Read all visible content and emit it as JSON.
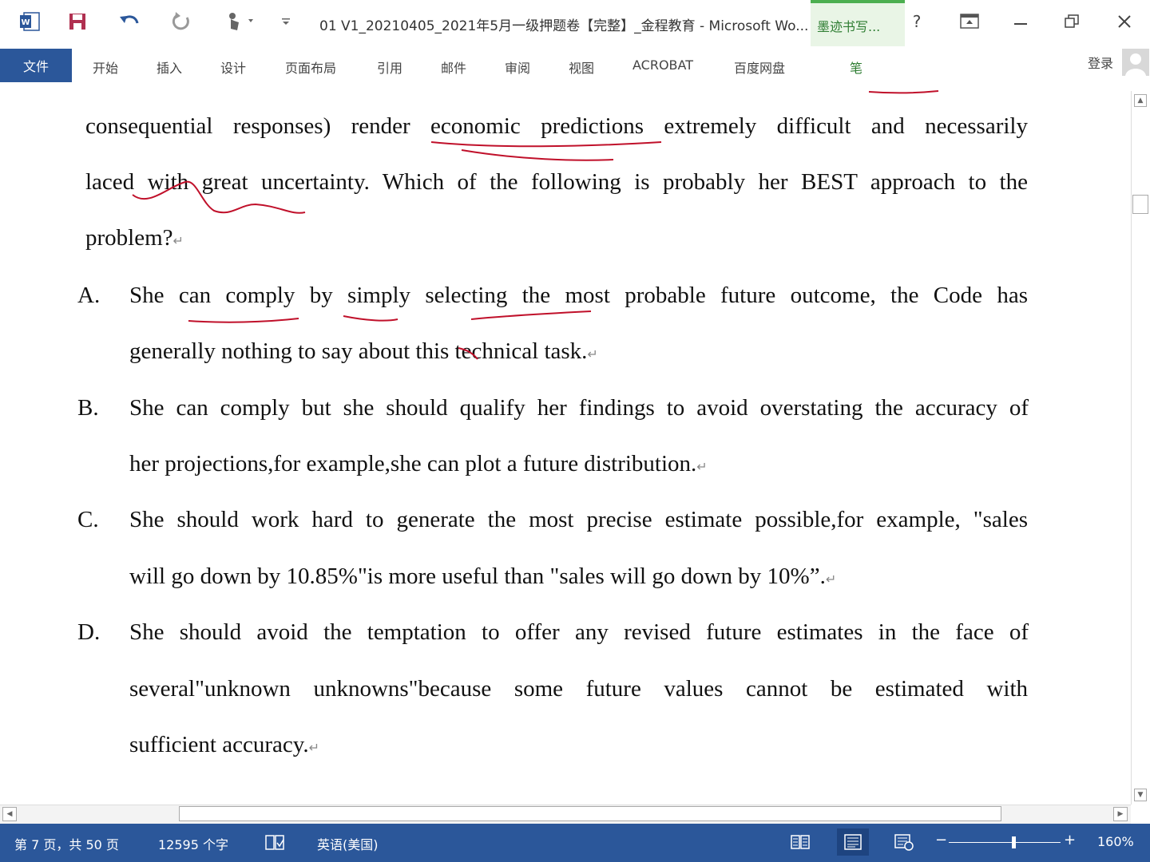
{
  "window": {
    "title": "01 V1_20210405_2021年5月一级押题卷【完整】_金程教育 - Microsoft Wo...",
    "pen_tools": "墨迹书写...",
    "help": "?"
  },
  "ribbon": {
    "file": "文件",
    "tabs": [
      "开始",
      "插入",
      "设计",
      "页面布局",
      "引用",
      "邮件",
      "审阅",
      "视图",
      "ACROBAT",
      "百度网盘"
    ],
    "pen": "笔",
    "login": "登录"
  },
  "document": {
    "stem_line1": "consequential responses) render economic predictions extremely difficult and necessarily",
    "stem_line2": "laced with great uncertainty. Which of the following is probably her BEST approach to the",
    "stem_line3": "problem?",
    "paragraph_mark": "↵",
    "options": [
      {
        "letter": "A.",
        "line1": "She can comply by simply selecting the most probable future outcome, the Code has",
        "line2": "generally nothing to say about this technical task."
      },
      {
        "letter": "B.",
        "line1": "She can comply but she should qualify her findings to avoid overstating the accuracy of",
        "line2": "her projections,for example,she can plot a future distribution."
      },
      {
        "letter": "C.",
        "line1": "She should work hard to generate the most precise estimate possible,for example, \"sales",
        "line2": "will go down by 10.85%\"is more useful than \"sales will go down by 10%”."
      },
      {
        "letter": "D.",
        "line1": "She should avoid the temptation to offer any revised future estimates in the face of",
        "line2": "several\"unknown unknowns\"because some future values cannot be estimated with",
        "line3": "sufficient accuracy."
      }
    ]
  },
  "status": {
    "page": "第 7 页，共 50 页",
    "words": "12595 个字",
    "language": "英语(美国)",
    "zoom": "160%",
    "zoom_level_fraction": 0.58
  },
  "colors": {
    "accent": "#2b579a",
    "ink": "#c0102a",
    "pen_tab": "#e9f5e6"
  }
}
